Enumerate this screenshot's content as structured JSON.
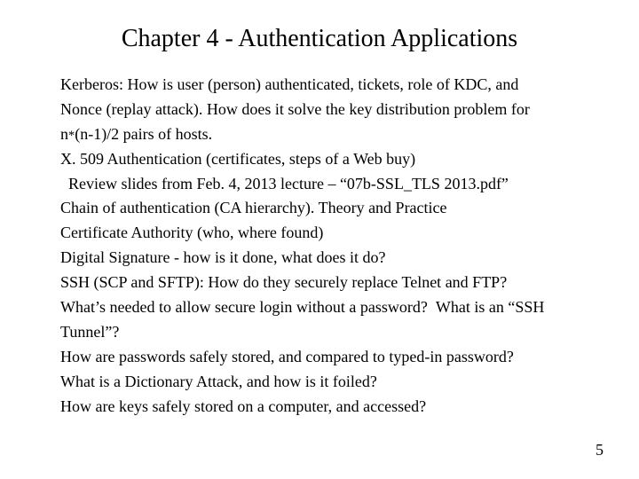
{
  "title": "Chapter 4 - Authentication Applications",
  "body": {
    "l1": "Kerberos: How is user (person) authenticated, tickets, role of KDC, and",
    "l2": "Nonce (replay attack). How does it solve the key distribution problem for",
    "l3a": "n",
    "l3b": "*",
    "l3c": "(n-1)/2 pairs of hosts.",
    "l4": "X. 509 Authentication (certificates, steps of a Web buy)",
    "l5": "  Review slides from Feb. 4, 2013 lecture – “07b-SSL_TLS 2013.pdf”",
    "l6": "Chain of authentication (CA hierarchy). Theory and Practice",
    "l7": "Certificate Authority (who, where found)",
    "l8": "Digital Signature - how is it done, what does it do?",
    "l9": "SSH (SCP and SFTP): How do they securely replace Telnet and FTP?",
    "l10": "What’s needed to allow secure login without a password?  What is an “SSH",
    "l11": "Tunnel”?",
    "l12": "How are passwords safely stored, and compared to typed-in password?",
    "l13": "What is a Dictionary Attack, and how is it foiled?",
    "l14": "How are keys safely stored on a computer, and accessed?"
  },
  "page_number": "5"
}
